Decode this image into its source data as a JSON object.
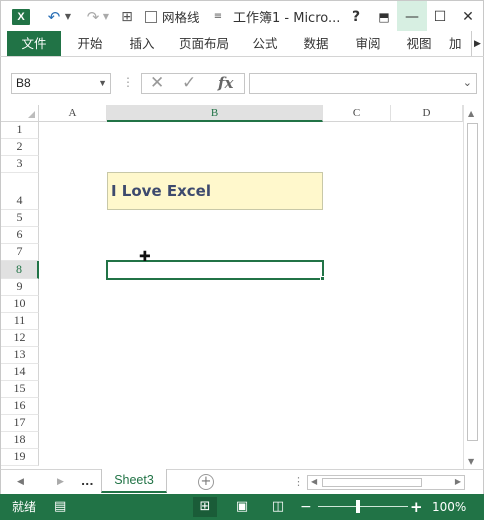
{
  "titlebar": {
    "app_icon": "X",
    "gridlines_label": "网格线",
    "title": "工作簿1 - Micro...",
    "help": "?",
    "undo_icon": "undo-icon",
    "redo_icon": "redo-icon"
  },
  "tabs": [
    {
      "label": "文件",
      "active": true
    },
    {
      "label": "开始"
    },
    {
      "label": "插入"
    },
    {
      "label": "页面布局"
    },
    {
      "label": "公式"
    },
    {
      "label": "数据"
    },
    {
      "label": "审阅"
    },
    {
      "label": "视图"
    },
    {
      "label": "加载"
    }
  ],
  "formula_bar": {
    "name_box": "B8",
    "fx": "fx",
    "formula_value": ""
  },
  "columns": [
    "A",
    "B",
    "C",
    "D"
  ],
  "rows": [
    "1",
    "2",
    "3",
    "4",
    "5",
    "6",
    "7",
    "8",
    "9",
    "10",
    "11",
    "12",
    "13",
    "14",
    "15",
    "16",
    "17",
    "18",
    "19"
  ],
  "cells": {
    "B4": "I Love Excel"
  },
  "selected_cell": "B8",
  "sheets": {
    "ellipsis": "...",
    "active": "Sheet3",
    "add": "+"
  },
  "status": {
    "ready": "就绪",
    "zoom": "100%",
    "zoom_minus": "−",
    "zoom_plus": "+"
  },
  "colors": {
    "accent": "#217346",
    "cell_fill": "#fff8cc",
    "cell_text": "#3e4a6e"
  }
}
